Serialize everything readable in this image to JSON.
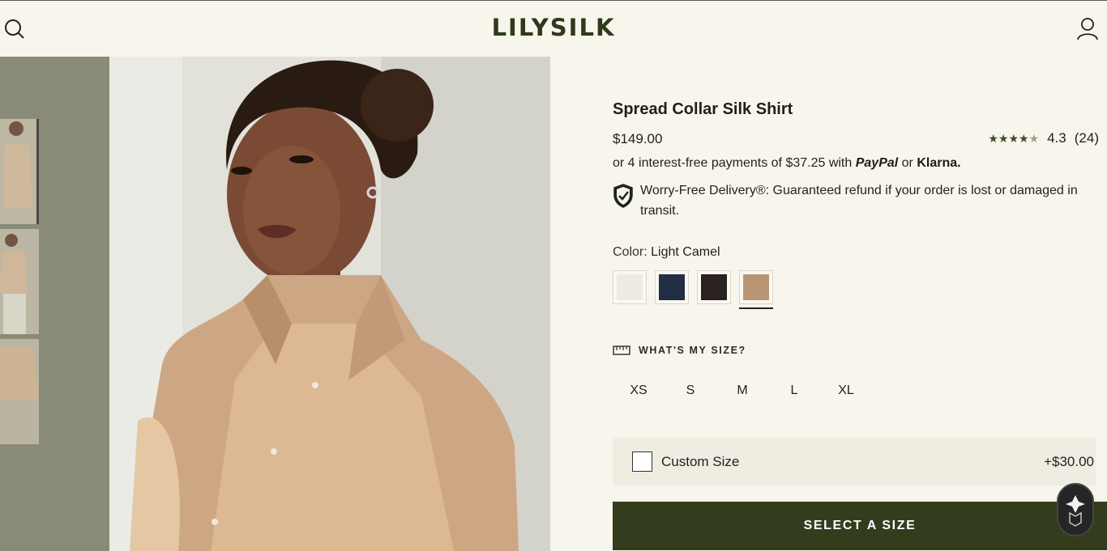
{
  "header": {
    "brand": "LILYSILK",
    "search_icon": "search-icon",
    "account_icon": "user-icon"
  },
  "gallery": {
    "thumbnail_count": 3
  },
  "product": {
    "title": "Spread Collar Silk Shirt",
    "price": "$149.00",
    "rating": {
      "value": "4.3",
      "count": "(24)",
      "stars": 4.3
    },
    "installments": {
      "prefix": "or 4 interest-free payments of ",
      "amount": "$37.25",
      "with": " with ",
      "paypal": "PayPal",
      "or": " or ",
      "klarna": "Klarna."
    },
    "delivery": {
      "title": "Worry-Free Delivery®:",
      "text": " Guaranteed refund if your order is lost or damaged in transit."
    },
    "color": {
      "label": "Color:",
      "selected": "Light Camel",
      "swatches": [
        {
          "name": "Ivory",
          "hex": "#efebe2"
        },
        {
          "name": "Navy",
          "hex": "#232d45"
        },
        {
          "name": "Black",
          "hex": "#2a2220"
        },
        {
          "name": "Light Camel",
          "hex": "#b89574"
        }
      ]
    },
    "size_guide": "WHAT'S MY SIZE?",
    "sizes": [
      "XS",
      "S",
      "M",
      "L",
      "XL"
    ],
    "custom_size": {
      "label": "Custom Size",
      "price": "+$30.00"
    },
    "cta": "SELECT A SIZE"
  },
  "colors": {
    "background": "#f8f6ec",
    "brand": "#2f3a1d",
    "cta": "#333d1d"
  }
}
